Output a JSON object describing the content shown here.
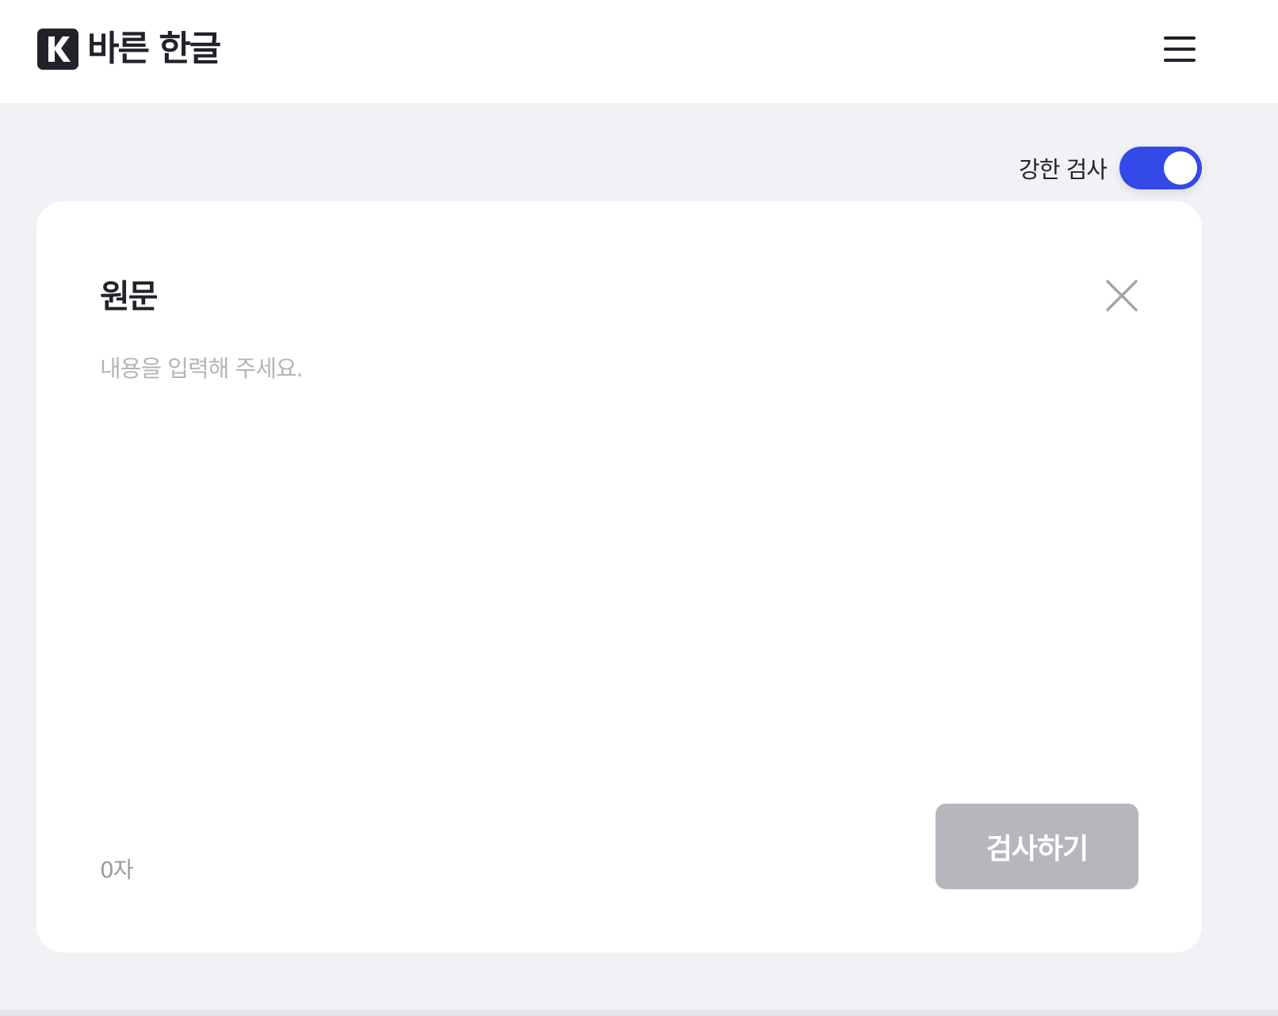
{
  "header": {
    "logo_letter": "K",
    "app_name": "바른 한글",
    "menu_icon": "hamburger-menu-icon"
  },
  "options": {
    "strict_check_label": "강한 검사",
    "strict_check_enabled": true,
    "toggle_color": "#3349e8"
  },
  "editor": {
    "title": "원문",
    "close_icon": "close-icon",
    "value": "",
    "placeholder": "내용을 입력해 주세요.",
    "char_count": "0자",
    "submit_label": "검사하기",
    "submit_enabled": false
  },
  "colors": {
    "background": "#f1f2f6",
    "card": "#ffffff",
    "text": "#22232a",
    "disabled_button": "#b6b7bd"
  }
}
